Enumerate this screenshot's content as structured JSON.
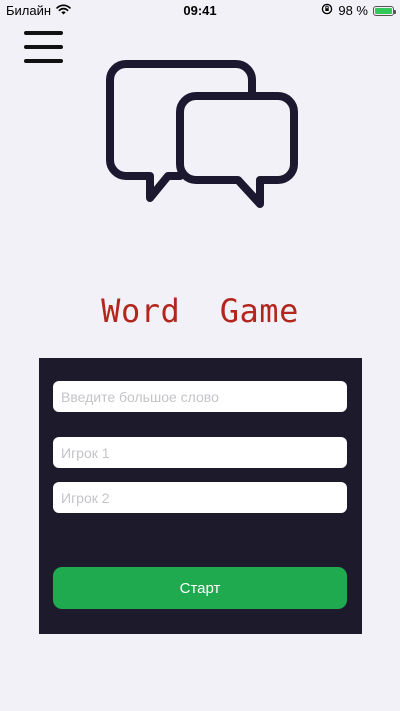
{
  "status_bar": {
    "carrier": "Билайн",
    "time": "09:41",
    "battery_percent": "98 %",
    "battery_level": 0.98,
    "icons": [
      "wifi-icon",
      "orientation-lock-icon",
      "battery-icon"
    ]
  },
  "header": {
    "menu_icon": "hamburger-menu-icon"
  },
  "logo": {
    "icon": "chat-bubbles-icon",
    "stroke_color": "#1b1830"
  },
  "title": "Word  Game",
  "form": {
    "word_placeholder": "Введите большое слово",
    "player1_placeholder": "Игрок 1",
    "player2_placeholder": "Игрок 2",
    "start_label": "Старт"
  },
  "colors": {
    "background": "#f2f1f7",
    "panel": "#1d1a2c",
    "title": "#b3261e",
    "start_button": "#1faa4f"
  }
}
